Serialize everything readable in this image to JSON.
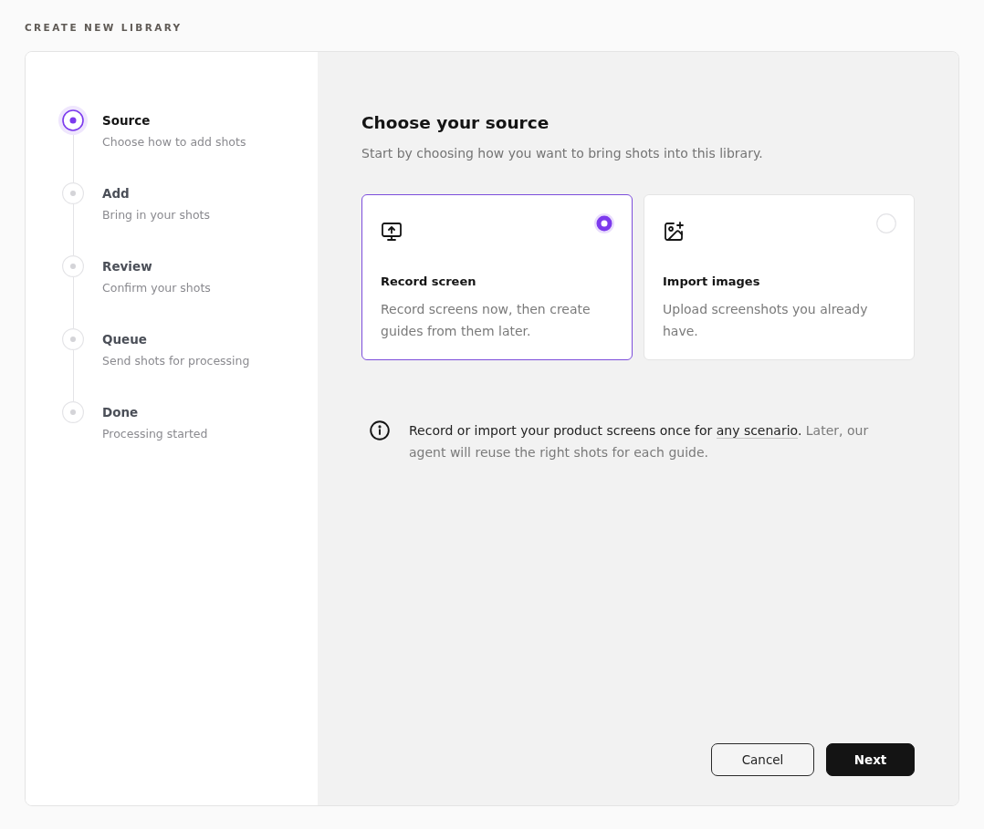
{
  "page_title": "CREATE NEW LIBRARY",
  "steps": [
    {
      "label": "Source",
      "description": "Choose how to add shots",
      "selected": true
    },
    {
      "label": "Add",
      "description": "Bring in your shots",
      "selected": false
    },
    {
      "label": "Review",
      "description": "Confirm your shots",
      "selected": false
    },
    {
      "label": "Queue",
      "description": "Send shots for processing",
      "selected": false
    },
    {
      "label": "Done",
      "description": "Processing started",
      "selected": false
    }
  ],
  "heading": "Choose your source",
  "subtitle": "Start by choosing how you want to bring shots into this library.",
  "options": [
    {
      "kind": "record",
      "title": "Record screen",
      "description": "Record screens now, then create guides from them later.",
      "selected": true
    },
    {
      "kind": "import",
      "title": "Import images",
      "description": "Upload screenshots you already have.",
      "selected": false
    }
  ],
  "info": {
    "parts": [
      {
        "kind": "plain",
        "text": "Record or import your product screens once for "
      },
      {
        "kind": "link",
        "text": "any scenario"
      },
      {
        "kind": "plain",
        "text": "."
      },
      {
        "kind": "muted",
        "text": " Later, our agent will reuse the right shots for each guide."
      }
    ]
  },
  "buttons": [
    {
      "kind": "secondary",
      "label": "Cancel"
    },
    {
      "kind": "primary",
      "label": "Next"
    }
  ]
}
